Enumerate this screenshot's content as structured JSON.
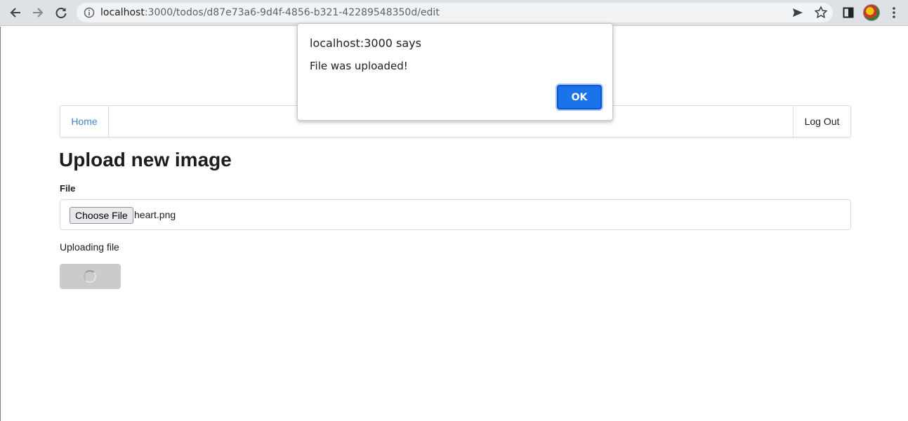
{
  "browser": {
    "url_host": "localhost",
    "url_rest": ":3000/todos/d87e73a6-9d4f-4856-b321-42289548350d/edit",
    "icons": [
      "back-icon",
      "forward-icon",
      "reload-icon",
      "info-icon",
      "send-icon",
      "bookmark-star-icon",
      "side-panel-icon",
      "profile-avatar",
      "kebab-menu-icon"
    ]
  },
  "nav": {
    "home_label": "Home",
    "logout_label": "Log Out"
  },
  "main": {
    "title": "Upload new image",
    "file_label": "File",
    "choose_file_label": "Choose File",
    "selected_file": "heart.png",
    "status": "Uploading file"
  },
  "dialog": {
    "title": "localhost:3000 says",
    "message": "File was uploaded!",
    "ok_label": "OK"
  },
  "colors": {
    "link": "#4183c4",
    "ok_button": "#1a73e8",
    "loading_button": "#cacbcd"
  }
}
